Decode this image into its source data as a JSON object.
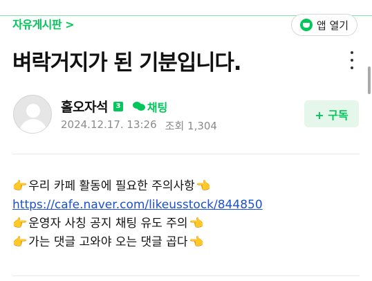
{
  "header": {
    "board_link": "자유게시판 >",
    "app_button": "앱 열기"
  },
  "post": {
    "title": "벼락거지가 된 기분입니다.",
    "author": {
      "name": "홀오자석",
      "level": "3",
      "chat_label": "채팅"
    },
    "date": "2024.12.17. 13:26",
    "views": "조회 1,304",
    "subscribe_label": "+ 구독"
  },
  "content": {
    "lines": [
      "우리 카페 활동에 필요한 주의사항",
      "https://cafe.naver.com/likeusstock/844850",
      "운영자 사칭 공지 채팅 유도 주의",
      "가는 댓글 고와야 오는 댓글 곱다"
    ]
  },
  "icons": {
    "hand": "👉"
  },
  "colors": {
    "accent": "#03c75a",
    "link": "#1a4fcf"
  }
}
